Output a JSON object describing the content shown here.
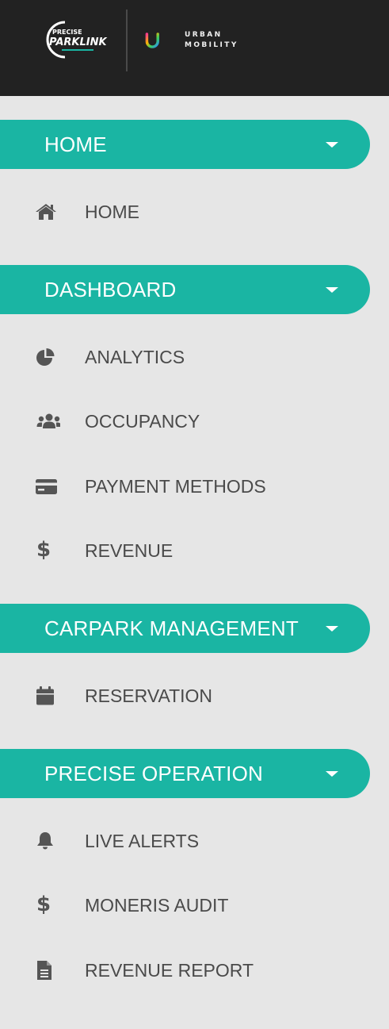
{
  "branding": {
    "ppl_logo_top": "PRECISE",
    "ppl_logo_main": "PARKLINK",
    "um_line1": "URBAN",
    "um_line2": "MOBILITY"
  },
  "colors": {
    "topbar": "#222222",
    "sidebar_bg": "#e6e6e6",
    "section_accent": "#1ab5a3",
    "item_text": "#4a4a4a",
    "icon": "#555555"
  },
  "sections": [
    {
      "label": "HOME",
      "items": [
        {
          "label": "HOME",
          "icon": "home-icon"
        }
      ]
    },
    {
      "label": "DASHBOARD",
      "items": [
        {
          "label": "ANALYTICS",
          "icon": "pie-chart-icon"
        },
        {
          "label": "OCCUPANCY",
          "icon": "users-icon"
        },
        {
          "label": "PAYMENT METHODS",
          "icon": "credit-card-icon"
        },
        {
          "label": "REVENUE",
          "icon": "dollar-icon"
        }
      ]
    },
    {
      "label": "CARPARK MANAGEMENT",
      "items": [
        {
          "label": "RESERVATION",
          "icon": "calendar-icon"
        }
      ]
    },
    {
      "label": "PRECISE OPERATION",
      "items": [
        {
          "label": "LIVE ALERTS",
          "icon": "bell-icon"
        },
        {
          "label": "MONERIS AUDIT",
          "icon": "dollar-icon"
        },
        {
          "label": "REVENUE REPORT",
          "icon": "file-icon"
        }
      ]
    }
  ]
}
